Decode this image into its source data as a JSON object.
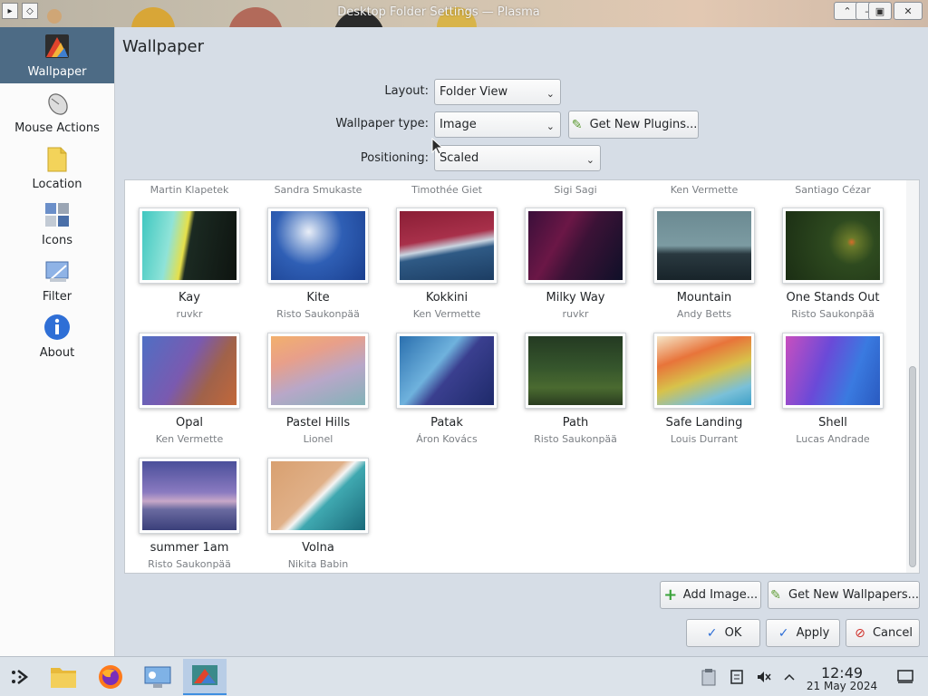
{
  "window": {
    "title": "Desktop Folder Settings — Plasma",
    "buttons": {
      "keep_above": "⌃",
      "minimize": "–",
      "maximize": "▣",
      "close": "✕"
    }
  },
  "sidebar": {
    "items": [
      {
        "label": "Wallpaper",
        "icon": "wallpaper-icon",
        "active": true
      },
      {
        "label": "Mouse Actions",
        "icon": "mouse-icon"
      },
      {
        "label": "Location",
        "icon": "folder-icon"
      },
      {
        "label": "Icons",
        "icon": "icons-grid-icon"
      },
      {
        "label": "Filter",
        "icon": "filter-icon"
      },
      {
        "label": "About",
        "icon": "info-icon"
      }
    ]
  },
  "main": {
    "title": "Wallpaper",
    "layout": {
      "label": "Layout:",
      "value": "Folder View"
    },
    "wallpaper_type": {
      "label": "Wallpaper type:",
      "value": "Image"
    },
    "get_new_plugins": "Get New Plugins...",
    "positioning": {
      "label": "Positioning:",
      "value": "Scaled"
    },
    "cut_off_authors": [
      "Martin Klapetek",
      "Sandra Smukaste",
      "Timothée Giet",
      "Sigi Sagi",
      "Ken Vermette",
      "Santiago Cézar"
    ],
    "wallpapers": [
      {
        "name": "Kay",
        "author": "ruvkr"
      },
      {
        "name": "Kite",
        "author": "Risto Saukonpää"
      },
      {
        "name": "Kokkini",
        "author": "Ken Vermette"
      },
      {
        "name": "Milky Way",
        "author": "ruvkr"
      },
      {
        "name": "Mountain",
        "author": "Andy Betts"
      },
      {
        "name": "One Stands Out",
        "author": "Risto Saukonpää"
      },
      {
        "name": "Opal",
        "author": "Ken Vermette"
      },
      {
        "name": "Pastel Hills",
        "author": "Lionel"
      },
      {
        "name": "Patak",
        "author": "Áron Kovács"
      },
      {
        "name": "Path",
        "author": "Risto Saukonpää"
      },
      {
        "name": "Safe Landing",
        "author": "Louis Durrant"
      },
      {
        "name": "Shell",
        "author": "Lucas Andrade"
      },
      {
        "name": "summer 1am",
        "author": "Risto Saukonpää"
      },
      {
        "name": "Volna",
        "author": "Nikita Babin"
      }
    ],
    "add_image": "Add Image...",
    "get_new_wallpapers": "Get New Wallpapers...",
    "ok": "OK",
    "apply": "Apply",
    "cancel": "Cancel"
  },
  "taskbar": {
    "apps": [
      "application-launcher-icon",
      "file-manager-icon",
      "firefox-icon",
      "system-settings-icon",
      "desktop-settings-icon"
    ],
    "tray": [
      "clipboard-icon",
      "notes-icon",
      "volume-muted-icon",
      "tray-expand-icon",
      "show-desktop-icon"
    ],
    "time": "12:49",
    "date": "21 May 2024"
  },
  "colors": {
    "accent": "#4d6b85",
    "window_bg": "#d6dde6",
    "panel_bg": "#ffffff"
  }
}
